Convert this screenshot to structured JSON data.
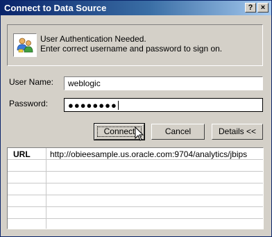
{
  "window": {
    "title": "Connect to Data Source",
    "help_button": "?",
    "close_button": "×"
  },
  "info": {
    "icon": "users-icon",
    "line1": "User Authentication Needed.",
    "line2": "Enter correct username and password to sign on."
  },
  "form": {
    "username_label": "User Name:",
    "username_value": "weblogic",
    "password_label": "Password:",
    "password_mask": "●●●●●●●●"
  },
  "buttons": {
    "connect": "Connect",
    "cancel": "Cancel",
    "details": "Details <<"
  },
  "details_table": {
    "rows": [
      {
        "key": "URL",
        "value": "http://obieesample.us.oracle.com:9704/analytics/jbips"
      },
      {
        "key": "",
        "value": ""
      },
      {
        "key": "",
        "value": ""
      },
      {
        "key": "",
        "value": ""
      },
      {
        "key": "",
        "value": ""
      },
      {
        "key": "",
        "value": ""
      }
    ]
  },
  "colors": {
    "title_bar_start": "#0a246a",
    "title_bar_end": "#a6caf0",
    "dialog_face": "#d4d0c8"
  }
}
